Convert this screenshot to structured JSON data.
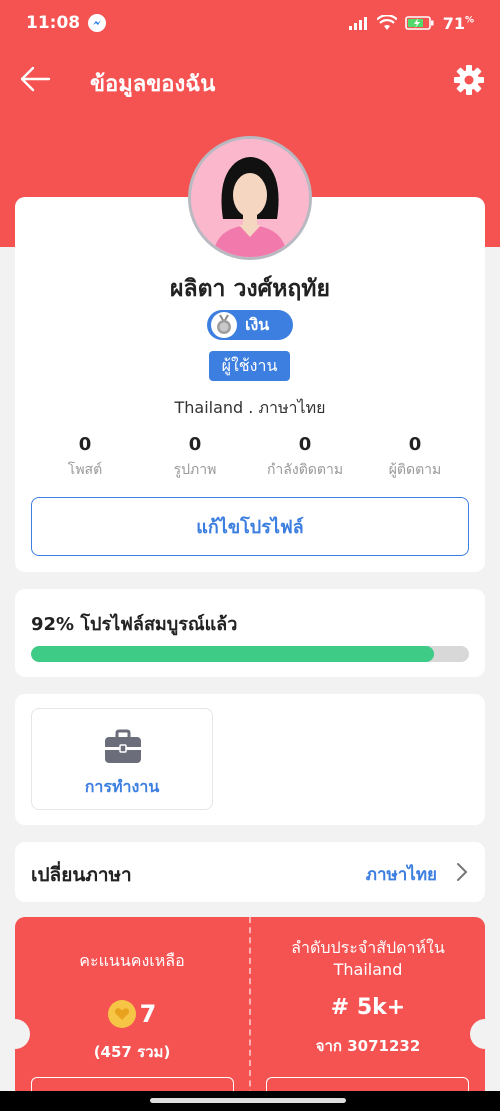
{
  "status_bar": {
    "time": "11:08",
    "battery": "71",
    "battery_unit": "%"
  },
  "header": {
    "title": "ข้อมูลของฉัน"
  },
  "profile": {
    "name": "ผลิตา วงศ์หฤทัย",
    "level_badge": "เงิน",
    "role_badge": "ผู้ใช้งาน",
    "location": "Thailand . ภาษาไทย",
    "stats": [
      {
        "value": "0",
        "label": "โพสต์"
      },
      {
        "value": "0",
        "label": "รูปภาพ"
      },
      {
        "value": "0",
        "label": "กำลังติดตาม"
      },
      {
        "value": "0",
        "label": "ผู้ติดตาม"
      }
    ],
    "edit_button": "แก้ไขโปรไฟล์"
  },
  "completion": {
    "title": "92% โปรไฟล์สมบูรณ์แล้ว",
    "percent": 92
  },
  "work": {
    "label": "การทำงาน"
  },
  "language": {
    "label": "เปลี่ยนภาษา",
    "value": "ภาษาไทย"
  },
  "points": {
    "label": "คะแนนคงเหลือ",
    "value": "7",
    "total": "(457 รวม)"
  },
  "rank": {
    "label": "ลำดับประจำสัปดาห์ใน Thailand",
    "value": "# 5k+",
    "from": "จาก 3071232"
  },
  "colors": {
    "brand_red": "#f55252",
    "accent_blue": "#3d7fe0",
    "progress_green": "#3dcb85"
  }
}
